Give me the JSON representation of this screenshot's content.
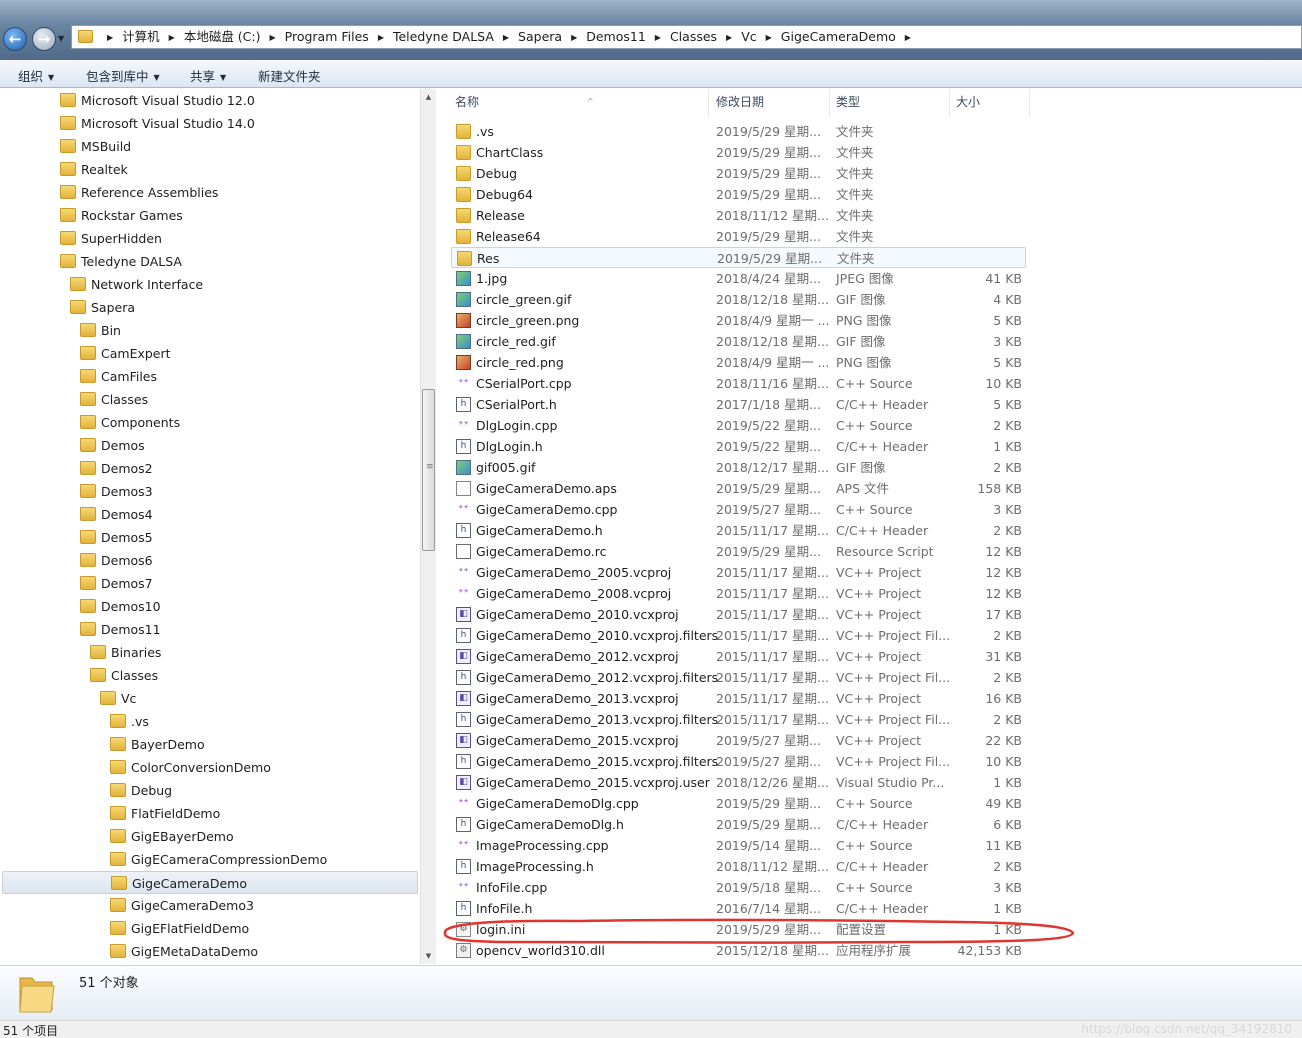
{
  "address": {
    "crumbs": [
      "计算机",
      "本地磁盘 (C:)",
      "Program Files",
      "Teledyne DALSA",
      "Sapera",
      "Demos11",
      "Classes",
      "Vc",
      "GigeCameraDemo"
    ]
  },
  "toolbar": {
    "organize": "组织",
    "include_library": "包含到库中",
    "share": "共享",
    "new_folder": "新建文件夹"
  },
  "tree": [
    {
      "label": "Microsoft Visual Studio 12.0",
      "indent": 0
    },
    {
      "label": "Microsoft Visual Studio 14.0",
      "indent": 0
    },
    {
      "label": "MSBuild",
      "indent": 0
    },
    {
      "label": "Realtek",
      "indent": 0
    },
    {
      "label": "Reference Assemblies",
      "indent": 0
    },
    {
      "label": "Rockstar Games",
      "indent": 0
    },
    {
      "label": "SuperHidden",
      "indent": 0
    },
    {
      "label": "Teledyne DALSA",
      "indent": 0
    },
    {
      "label": "Network Interface",
      "indent": 1
    },
    {
      "label": "Sapera",
      "indent": 1
    },
    {
      "label": "Bin",
      "indent": 2
    },
    {
      "label": "CamExpert",
      "indent": 2
    },
    {
      "label": "CamFiles",
      "indent": 2
    },
    {
      "label": "Classes",
      "indent": 2
    },
    {
      "label": "Components",
      "indent": 2
    },
    {
      "label": "Demos",
      "indent": 2
    },
    {
      "label": "Demos2",
      "indent": 2
    },
    {
      "label": "Demos3",
      "indent": 2
    },
    {
      "label": "Demos4",
      "indent": 2
    },
    {
      "label": "Demos5",
      "indent": 2
    },
    {
      "label": "Demos6",
      "indent": 2
    },
    {
      "label": "Demos7",
      "indent": 2
    },
    {
      "label": "Demos10",
      "indent": 2
    },
    {
      "label": "Demos11",
      "indent": 2
    },
    {
      "label": "Binaries",
      "indent": 3
    },
    {
      "label": "Classes",
      "indent": 3
    },
    {
      "label": "Vc",
      "indent": 4
    },
    {
      "label": ".vs",
      "indent": 5
    },
    {
      "label": "BayerDemo",
      "indent": 5
    },
    {
      "label": "ColorConversionDemo",
      "indent": 5
    },
    {
      "label": "Debug",
      "indent": 5
    },
    {
      "label": "FlatFieldDemo",
      "indent": 5
    },
    {
      "label": "GigEBayerDemo",
      "indent": 5
    },
    {
      "label": "GigECameraCompressionDemo",
      "indent": 5
    },
    {
      "label": "GigeCameraDemo",
      "indent": 5,
      "selected": true
    },
    {
      "label": "GigeCameraDemo3",
      "indent": 5
    },
    {
      "label": "GigEFlatFieldDemo",
      "indent": 5
    },
    {
      "label": "GigEMetaDataDemo",
      "indent": 5
    }
  ],
  "columns": {
    "name": "名称",
    "date": "修改日期",
    "type": "类型",
    "size": "大小"
  },
  "files": [
    {
      "name": ".vs",
      "date": "2019/5/29 星期...",
      "type": "文件夹",
      "size": "",
      "icon": "folder"
    },
    {
      "name": "ChartClass",
      "date": "2019/5/29 星期...",
      "type": "文件夹",
      "size": "",
      "icon": "folder"
    },
    {
      "name": "Debug",
      "date": "2019/5/29 星期...",
      "type": "文件夹",
      "size": "",
      "icon": "folder"
    },
    {
      "name": "Debug64",
      "date": "2019/5/29 星期...",
      "type": "文件夹",
      "size": "",
      "icon": "folder"
    },
    {
      "name": "Release",
      "date": "2018/11/12 星期...",
      "type": "文件夹",
      "size": "",
      "icon": "folder"
    },
    {
      "name": "Release64",
      "date": "2019/5/29 星期...",
      "type": "文件夹",
      "size": "",
      "icon": "folder"
    },
    {
      "name": "Res",
      "date": "2019/5/29 星期...",
      "type": "文件夹",
      "size": "",
      "icon": "folder",
      "highlight": true
    },
    {
      "name": "1.jpg",
      "date": "2018/4/24 星期...",
      "type": "JPEG 图像",
      "size": "41 KB",
      "icon": "img"
    },
    {
      "name": "circle_green.gif",
      "date": "2018/12/18 星期...",
      "type": "GIF 图像",
      "size": "4 KB",
      "icon": "img"
    },
    {
      "name": "circle_green.png",
      "date": "2018/4/9 星期一 ...",
      "type": "PNG 图像",
      "size": "5 KB",
      "icon": "png"
    },
    {
      "name": "circle_red.gif",
      "date": "2018/12/18 星期...",
      "type": "GIF 图像",
      "size": "3 KB",
      "icon": "img"
    },
    {
      "name": "circle_red.png",
      "date": "2018/4/9 星期一 ...",
      "type": "PNG 图像",
      "size": "5 KB",
      "icon": "png"
    },
    {
      "name": "CSerialPort.cpp",
      "date": "2018/11/16 星期...",
      "type": "C++ Source",
      "size": "10 KB",
      "icon": "cpp"
    },
    {
      "name": "CSerialPort.h",
      "date": "2017/1/18 星期...",
      "type": "C/C++ Header",
      "size": "5 KB",
      "icon": "h"
    },
    {
      "name": "DlgLogin.cpp",
      "date": "2019/5/22 星期...",
      "type": "C++ Source",
      "size": "2 KB",
      "icon": "cpp"
    },
    {
      "name": "DlgLogin.h",
      "date": "2019/5/22 星期...",
      "type": "C/C++ Header",
      "size": "1 KB",
      "icon": "h"
    },
    {
      "name": "gif005.gif",
      "date": "2018/12/17 星期...",
      "type": "GIF 图像",
      "size": "2 KB",
      "icon": "img"
    },
    {
      "name": "GigeCameraDemo.aps",
      "date": "2019/5/29 星期...",
      "type": "APS 文件",
      "size": "158 KB",
      "icon": "doc"
    },
    {
      "name": "GigeCameraDemo.cpp",
      "date": "2019/5/27 星期...",
      "type": "C++ Source",
      "size": "3 KB",
      "icon": "cpp"
    },
    {
      "name": "GigeCameraDemo.h",
      "date": "2015/11/17 星期...",
      "type": "C/C++ Header",
      "size": "2 KB",
      "icon": "h"
    },
    {
      "name": "GigeCameraDemo.rc",
      "date": "2019/5/29 星期...",
      "type": "Resource Script",
      "size": "12 KB",
      "icon": "rc"
    },
    {
      "name": "GigeCameraDemo_2005.vcproj",
      "date": "2015/11/17 星期...",
      "type": "VC++ Project",
      "size": "12 KB",
      "icon": "cpp"
    },
    {
      "name": "GigeCameraDemo_2008.vcproj",
      "date": "2015/11/17 星期...",
      "type": "VC++ Project",
      "size": "12 KB",
      "icon": "cpp"
    },
    {
      "name": "GigeCameraDemo_2010.vcxproj",
      "date": "2015/11/17 星期...",
      "type": "VC++ Project",
      "size": "17 KB",
      "icon": "proj"
    },
    {
      "name": "GigeCameraDemo_2010.vcxproj.filters",
      "date": "2015/11/17 星期...",
      "type": "VC++ Project Fil...",
      "size": "2 KB",
      "icon": "h"
    },
    {
      "name": "GigeCameraDemo_2012.vcxproj",
      "date": "2015/11/17 星期...",
      "type": "VC++ Project",
      "size": "31 KB",
      "icon": "proj"
    },
    {
      "name": "GigeCameraDemo_2012.vcxproj.filters",
      "date": "2015/11/17 星期...",
      "type": "VC++ Project Fil...",
      "size": "2 KB",
      "icon": "h"
    },
    {
      "name": "GigeCameraDemo_2013.vcxproj",
      "date": "2015/11/17 星期...",
      "type": "VC++ Project",
      "size": "16 KB",
      "icon": "proj"
    },
    {
      "name": "GigeCameraDemo_2013.vcxproj.filters",
      "date": "2015/11/17 星期...",
      "type": "VC++ Project Fil...",
      "size": "2 KB",
      "icon": "h"
    },
    {
      "name": "GigeCameraDemo_2015.vcxproj",
      "date": "2019/5/27 星期...",
      "type": "VC++ Project",
      "size": "22 KB",
      "icon": "proj"
    },
    {
      "name": "GigeCameraDemo_2015.vcxproj.filters",
      "date": "2019/5/27 星期...",
      "type": "VC++ Project Fil...",
      "size": "10 KB",
      "icon": "h"
    },
    {
      "name": "GigeCameraDemo_2015.vcxproj.user",
      "date": "2018/12/26 星期...",
      "type": "Visual Studio Pr...",
      "size": "1 KB",
      "icon": "proj"
    },
    {
      "name": "GigeCameraDemoDlg.cpp",
      "date": "2019/5/29 星期...",
      "type": "C++ Source",
      "size": "49 KB",
      "icon": "cpp"
    },
    {
      "name": "GigeCameraDemoDlg.h",
      "date": "2019/5/29 星期...",
      "type": "C/C++ Header",
      "size": "6 KB",
      "icon": "h"
    },
    {
      "name": "ImageProcessing.cpp",
      "date": "2019/5/14 星期...",
      "type": "C++ Source",
      "size": "11 KB",
      "icon": "cpp"
    },
    {
      "name": "ImageProcessing.h",
      "date": "2018/11/12 星期...",
      "type": "C/C++ Header",
      "size": "2 KB",
      "icon": "h"
    },
    {
      "name": "InfoFile.cpp",
      "date": "2019/5/18 星期...",
      "type": "C++ Source",
      "size": "3 KB",
      "icon": "cpp"
    },
    {
      "name": "InfoFile.h",
      "date": "2016/7/14 星期...",
      "type": "C/C++ Header",
      "size": "1 KB",
      "icon": "h"
    },
    {
      "name": "login.ini",
      "date": "2019/5/29 星期...",
      "type": "配置设置",
      "size": "1 KB",
      "icon": "ini"
    },
    {
      "name": "opencv_world310.dll",
      "date": "2015/12/18 星期...",
      "type": "应用程序扩展",
      "size": "42,153 KB",
      "icon": "dll"
    }
  ],
  "details": {
    "count": "51 个对象"
  },
  "status": {
    "text": "51 个项目",
    "watermark": "https://blog.csdn.net/qq_34192810"
  }
}
